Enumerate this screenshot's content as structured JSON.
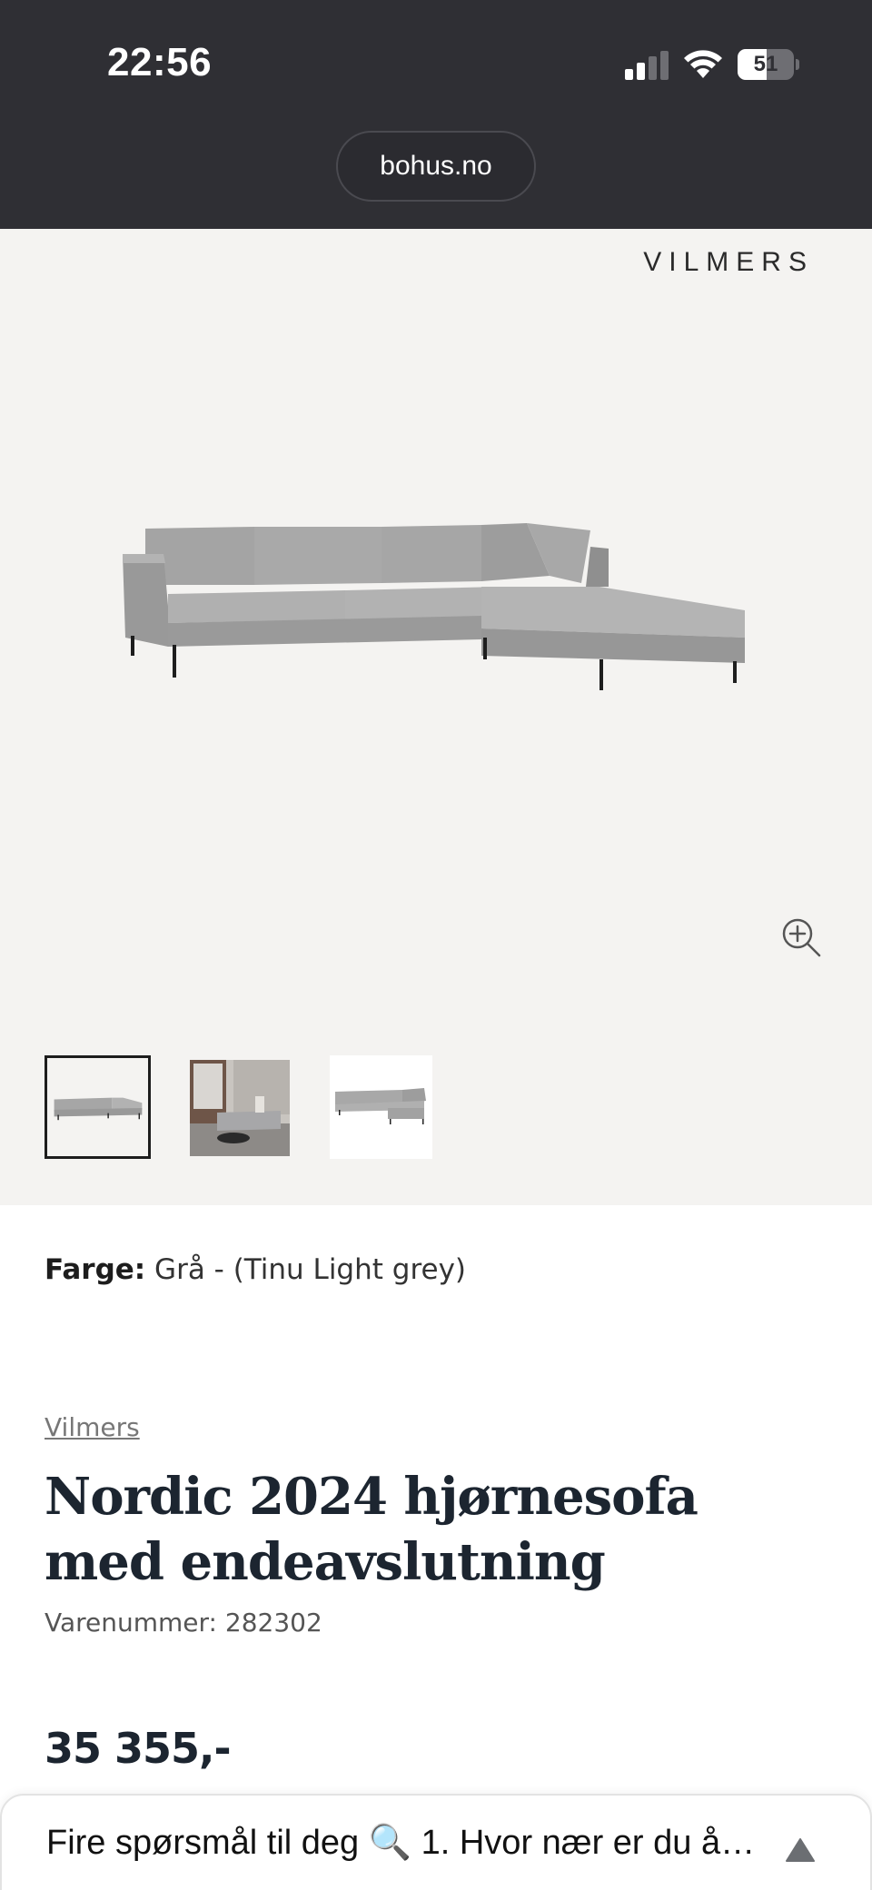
{
  "status_bar": {
    "time": "22:56",
    "battery": "51",
    "battery_level": 0.51,
    "icons": [
      "cellular-signal-icon",
      "wifi-icon",
      "battery-icon"
    ]
  },
  "browser": {
    "url": "bohus.no"
  },
  "gallery": {
    "brand_logo": "VILMERS",
    "zoom_icon": "zoom-in-icon",
    "thumbnail_count": 3,
    "selected_thumbnail": 1
  },
  "product": {
    "color_label": "Farge:",
    "color_value": "Grå - (Tinu Light grey)",
    "brand": "Vilmers",
    "title": "Nordic 2024 hjørnesofa med endeavslutning",
    "sku": "Varenummer: 282302",
    "price": "35 355,-"
  },
  "chat_sheet": {
    "text": "Fire spørsmål til deg 🔍 1. Hvor nær er du å…",
    "arrow_icon": "caret-up-icon"
  },
  "colors": {
    "status_bg": "#2f2f34",
    "gallery_bg": "#f4f3f1",
    "title_text": "#1c2530",
    "sofa_grey": "#a9a9a9"
  }
}
